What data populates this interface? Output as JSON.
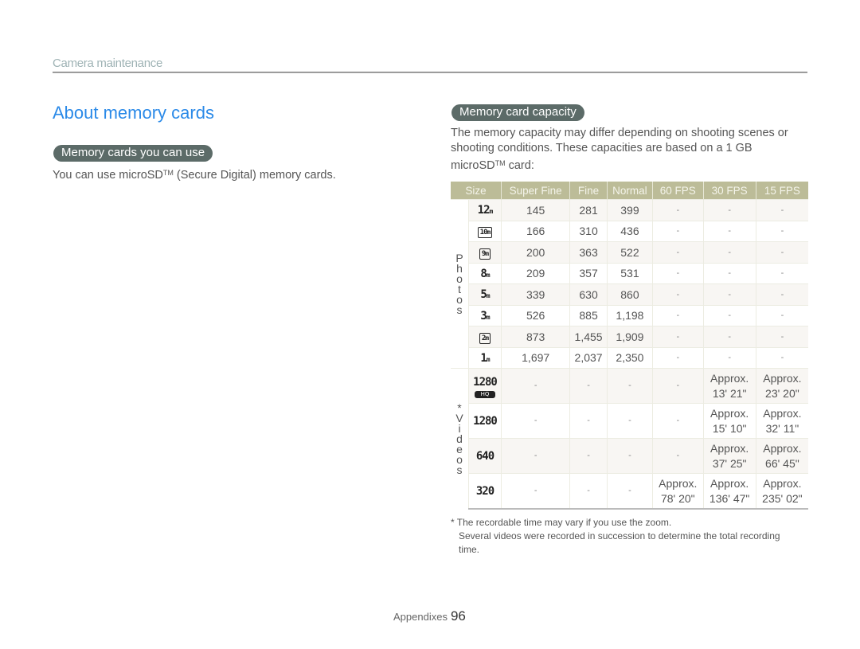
{
  "header": {
    "section": "Camera maintenance"
  },
  "page_title": "About memory cards",
  "left": {
    "pill": "Memory cards you can use",
    "text_before_tm": "You can use microSD",
    "tm": "TM",
    "text_after_tm": " (Secure Digital) memory cards."
  },
  "right": {
    "pill": "Memory card capacity",
    "text_before_tm": "The memory capacity may differ depending on shooting scenes or shooting conditions. These capacities are based on a 1 GB microSD",
    "tm": "TM",
    "text_after_tm": " card:"
  },
  "table": {
    "headers": [
      "Size",
      "Super Fine",
      "Fine",
      "Normal",
      "60 FPS",
      "30 FPS",
      "15 FPS"
    ],
    "photos_label": [
      "P",
      "h",
      "o",
      "t",
      "o",
      "s"
    ],
    "videos_label": [
      "*",
      "V",
      "i",
      "d",
      "e",
      "o",
      "s"
    ],
    "photos": [
      {
        "icon": "12m-icon",
        "size": "12M",
        "values": [
          "145",
          "281",
          "399",
          "-",
          "-",
          "-"
        ]
      },
      {
        "icon": "10m-wide-icon",
        "size": "10M",
        "values": [
          "166",
          "310",
          "436",
          "-",
          "-",
          "-"
        ]
      },
      {
        "icon": "9m-wide-icon",
        "size": "9M",
        "values": [
          "200",
          "363",
          "522",
          "-",
          "-",
          "-"
        ]
      },
      {
        "icon": "8m-icon",
        "size": "8M",
        "values": [
          "209",
          "357",
          "531",
          "-",
          "-",
          "-"
        ]
      },
      {
        "icon": "5m-icon",
        "size": "5M",
        "values": [
          "339",
          "630",
          "860",
          "-",
          "-",
          "-"
        ]
      },
      {
        "icon": "3m-icon",
        "size": "3M",
        "values": [
          "526",
          "885",
          "1,198",
          "-",
          "-",
          "-"
        ]
      },
      {
        "icon": "2m-wide-icon",
        "size": "2M",
        "values": [
          "873",
          "1,455",
          "1,909",
          "-",
          "-",
          "-"
        ]
      },
      {
        "icon": "1m-icon",
        "size": "1M",
        "values": [
          "1,697",
          "2,037",
          "2,350",
          "-",
          "-",
          "-"
        ]
      }
    ],
    "videos": [
      {
        "icon": "1280-hq-icon",
        "size": "1280",
        "badge": "HQ",
        "values": [
          "-",
          "-",
          "-",
          "-",
          "Approx.\n13' 21\"",
          "Approx.\n23' 20\""
        ]
      },
      {
        "icon": "1280-icon",
        "size": "1280",
        "values": [
          "-",
          "-",
          "-",
          "-",
          "Approx.\n15' 10\"",
          "Approx.\n32' 11\""
        ]
      },
      {
        "icon": "640-icon",
        "size": "640",
        "values": [
          "-",
          "-",
          "-",
          "-",
          "Approx.\n37' 25\"",
          "Approx.\n66' 45\""
        ]
      },
      {
        "icon": "320-icon",
        "size": "320",
        "values": [
          "-",
          "-",
          "-",
          "Approx.\n78' 20\"",
          "Approx.\n136' 47\"",
          "Approx.\n235' 02\""
        ]
      }
    ]
  },
  "footnote": {
    "line1": "* The recordable time may vary if you use the zoom.",
    "line2": "Several videos were recorded in succession to determine the total recording time."
  },
  "footer": {
    "label": "Appendixes",
    "page": "96"
  }
}
